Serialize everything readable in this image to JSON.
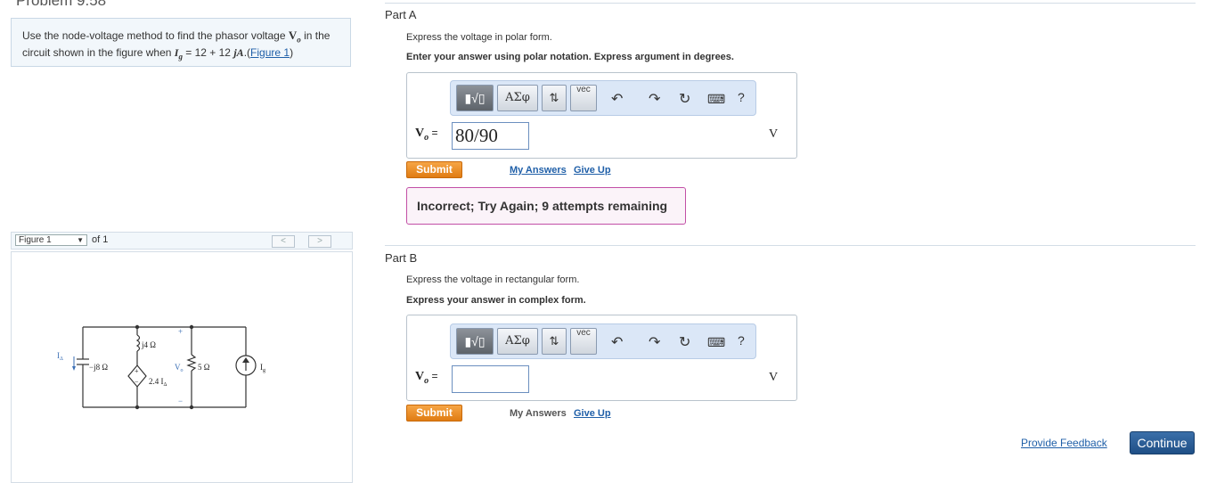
{
  "problem": {
    "title": "Problem 9.58",
    "text_1": "Use the node-voltage method to find the phasor voltage ",
    "symbol_v": "V",
    "symbol_v_sub": "o",
    "text_2": " in the circuit shown in the figure when ",
    "symbol_i": "I",
    "symbol_i_sub": "g",
    "text_3": " = 12 + 12 ",
    "symbol_j": "j",
    "symbol_a": "A",
    "text_4": ".(",
    "figure_link": "Figure 1",
    "text_5": ")"
  },
  "figure": {
    "select_value": "Figure 1",
    "of_text": "of 1",
    "prev": "<",
    "next": ">",
    "labels": {
      "idelta": "I",
      "idelta_sub": "Δ",
      "cap": "−j8 Ω",
      "ind": "j4 Ω",
      "dep_source": "2.4 I",
      "dep_sub": "Δ",
      "vo": "V",
      "vo_sub": "o",
      "res": "5 Ω",
      "ig": "I",
      "ig_sub": "g",
      "plus": "+",
      "minus": "−"
    }
  },
  "toolbar": {
    "templates": "▮√▯",
    "greek": "ΑΣφ",
    "arrows": "⇅",
    "vec": "vec",
    "undo_icon": "undo-icon",
    "redo_icon": "redo-icon",
    "reset_icon": "reset-icon",
    "keyboard_icon": "keyboard-icon",
    "help": "?"
  },
  "part_a": {
    "title": "Part A",
    "instruction_1": "Express the voltage in polar form.",
    "instruction_2": "Enter your answer using polar notation. Express argument in degrees.",
    "var_label": "V",
    "var_sub": "o",
    "equals": " = ",
    "input_value": "80/90",
    "unit": "V",
    "submit": "Submit",
    "my_answers": "My Answers",
    "give_up": "Give Up",
    "feedback": "Incorrect; Try Again; 9 attempts remaining"
  },
  "part_b": {
    "title": "Part B",
    "instruction_1": "Express the voltage in rectangular form.",
    "instruction_2": "Express your answer in complex form.",
    "var_label": "V",
    "var_sub": "o",
    "equals": " = ",
    "input_value": "",
    "unit": "V",
    "submit": "Submit",
    "my_answers": "My Answers",
    "give_up": "Give Up"
  },
  "footer": {
    "provide_feedback": "Provide Feedback",
    "continue": "Continue"
  },
  "colors": {
    "submit": "#e8871d",
    "continue": "#2b5f99",
    "feedback_border": "#c24fa6",
    "link": "#1f5fa8"
  }
}
